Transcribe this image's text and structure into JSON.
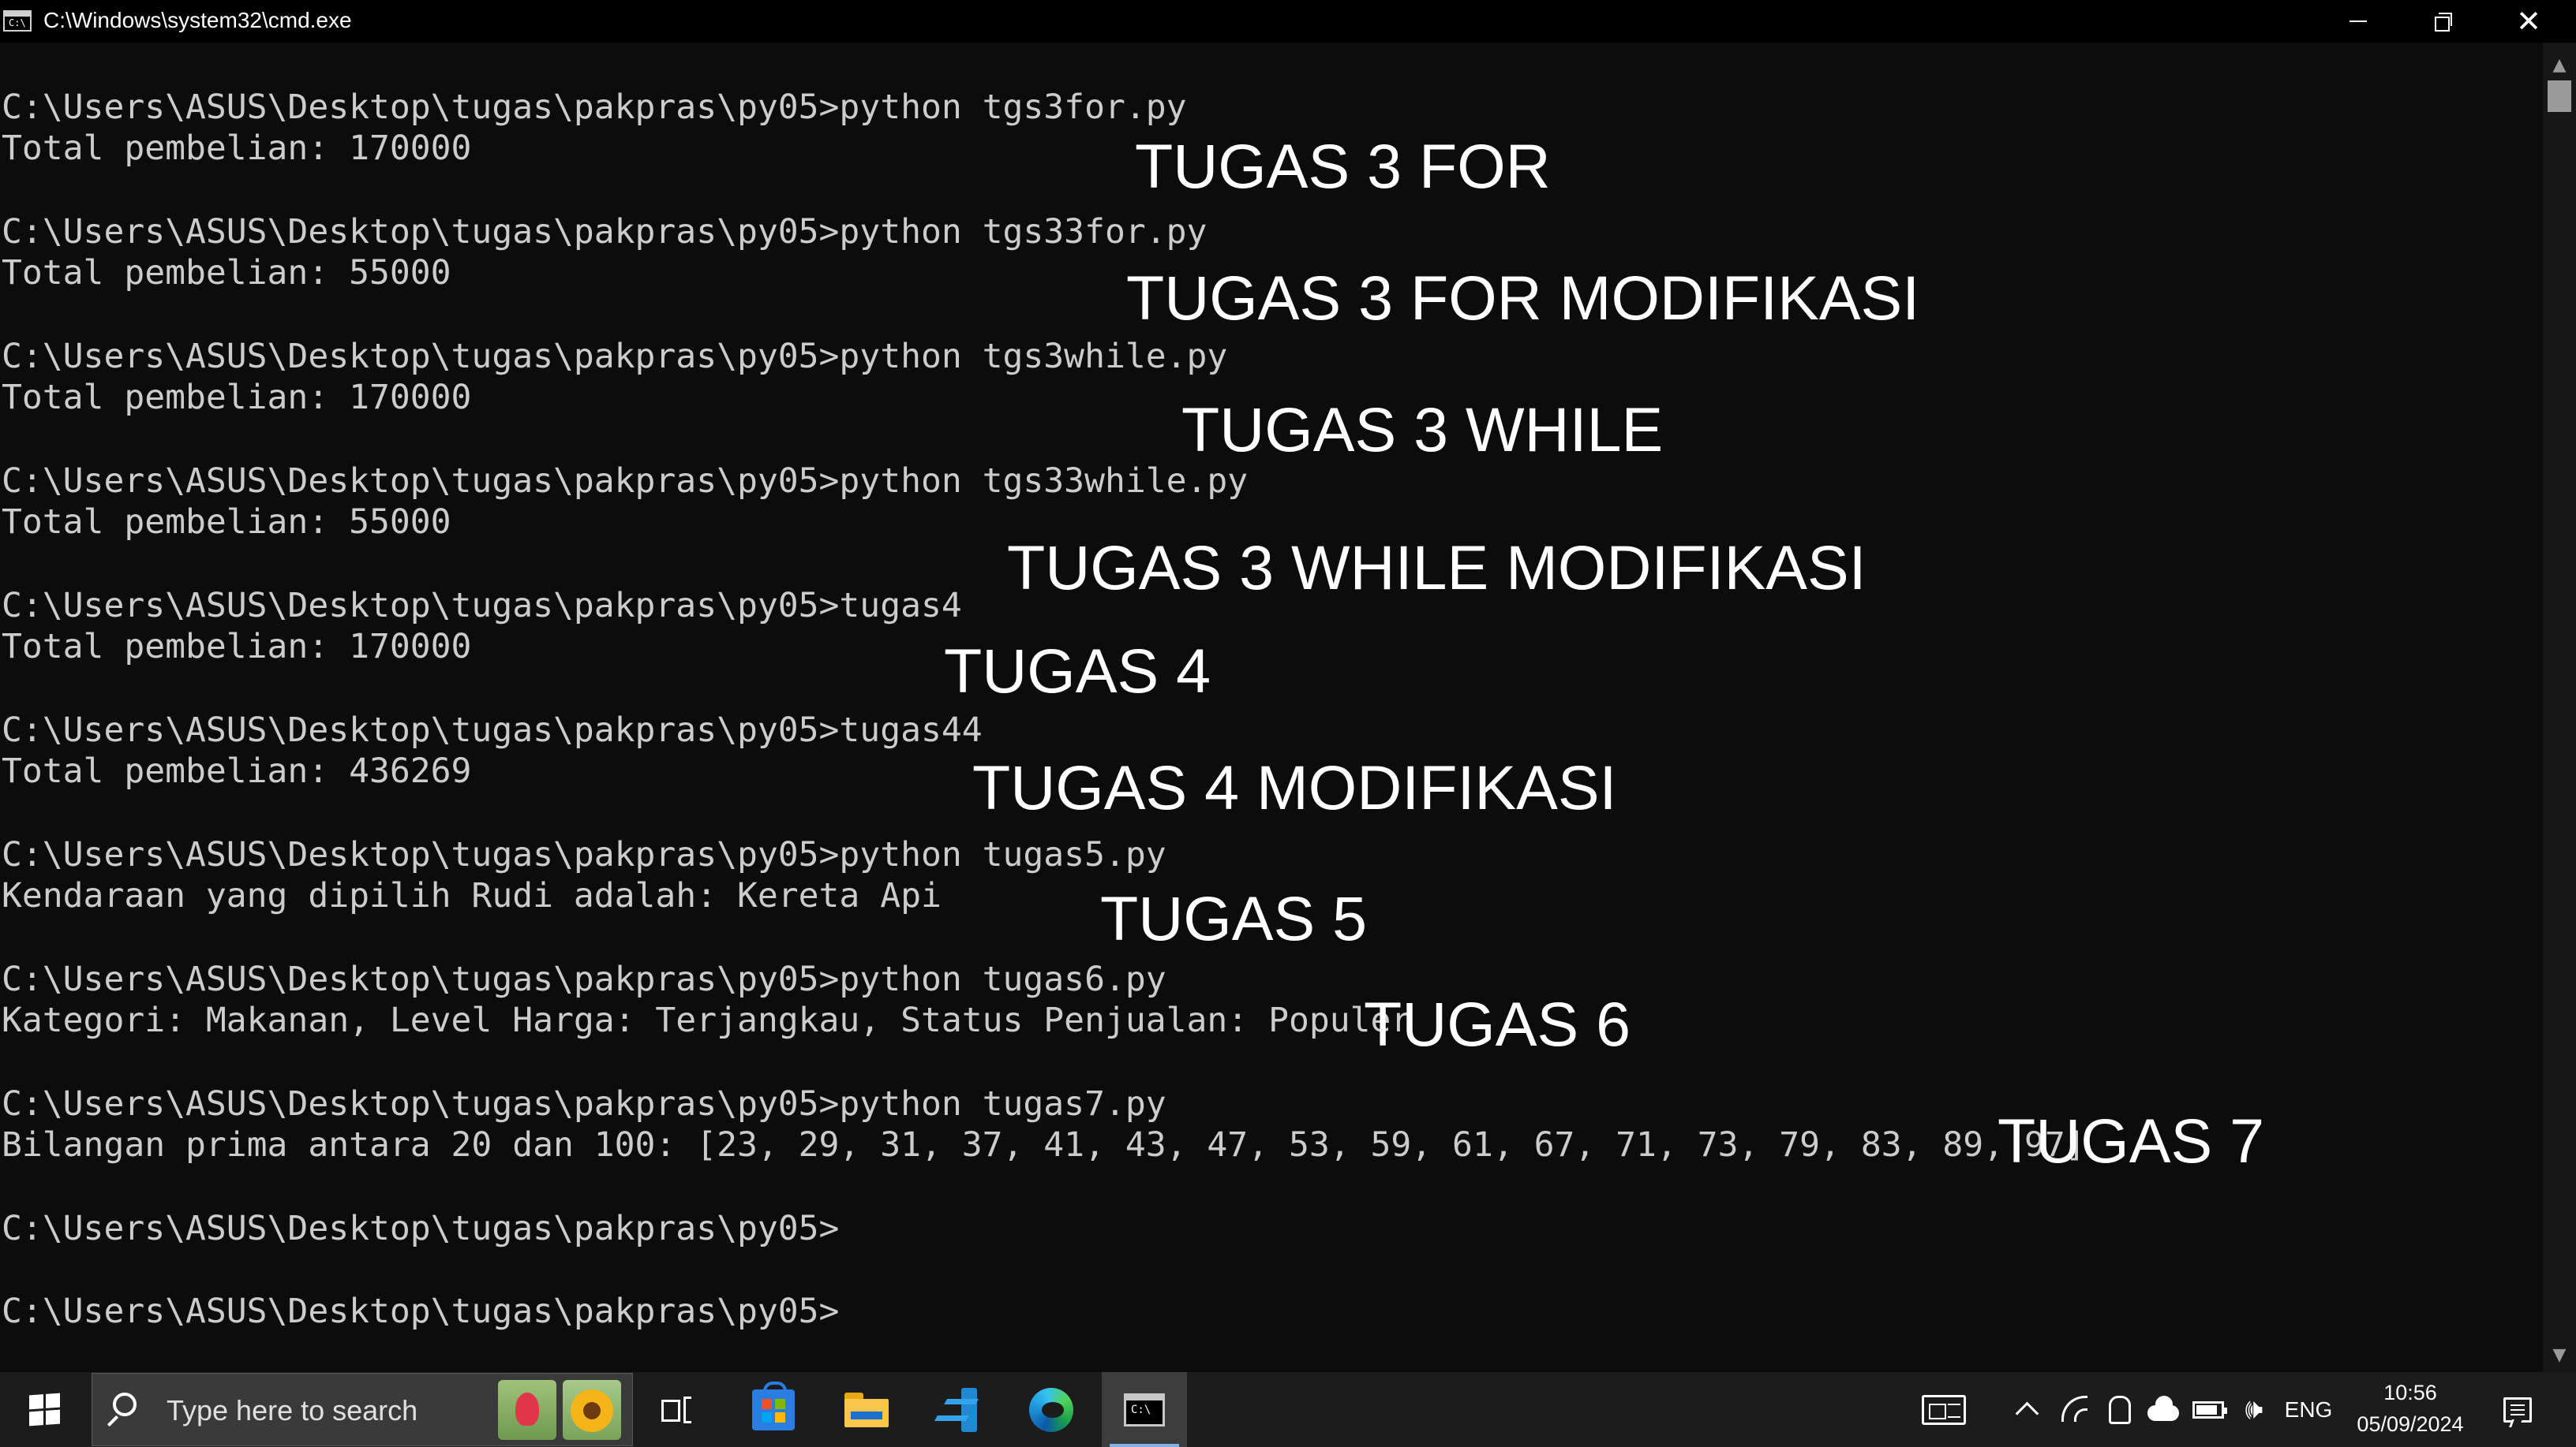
{
  "window": {
    "title": "C:\\Windows\\system32\\cmd.exe"
  },
  "terminal": {
    "lines": [
      "C:\\Users\\ASUS\\Desktop\\tugas\\pakpras\\py05>python tgs3for.py",
      "Total pembelian: 170000",
      "C:\\Users\\ASUS\\Desktop\\tugas\\pakpras\\py05>python tgs33for.py",
      "Total pembelian: 55000",
      "C:\\Users\\ASUS\\Desktop\\tugas\\pakpras\\py05>python tgs3while.py",
      "Total pembelian: 170000",
      "C:\\Users\\ASUS\\Desktop\\tugas\\pakpras\\py05>python tgs33while.py",
      "Total pembelian: 55000",
      "C:\\Users\\ASUS\\Desktop\\tugas\\pakpras\\py05>tugas4",
      "Total pembelian: 170000",
      "C:\\Users\\ASUS\\Desktop\\tugas\\pakpras\\py05>tugas44",
      "Total pembelian: 436269",
      "C:\\Users\\ASUS\\Desktop\\tugas\\pakpras\\py05>python tugas5.py",
      "Kendaraan yang dipilih Rudi adalah: Kereta Api",
      "C:\\Users\\ASUS\\Desktop\\tugas\\pakpras\\py05>python tugas6.py",
      "Kategori: Makanan, Level Harga: Terjangkau, Status Penjualan: Populer",
      "C:\\Users\\ASUS\\Desktop\\tugas\\pakpras\\py05>python tugas7.py",
      "Bilangan prima antara 20 dan 100: [23, 29, 31, 37, 41, 43, 47, 53, 59, 61, 67, 71, 73, 79, 83, 89, 97]",
      "C:\\Users\\ASUS\\Desktop\\tugas\\pakpras\\py05>",
      "C:\\Users\\ASUS\\Desktop\\tugas\\pakpras\\py05>"
    ]
  },
  "annotations": [
    "TUGAS 3 FOR",
    "TUGAS 3 FOR MODIFIKASI",
    "TUGAS 3 WHILE",
    "TUGAS 3 WHILE MODIFIKASI",
    "TUGAS 4",
    "TUGAS 4 MODIFIKASI",
    "TUGAS 5",
    "TUGAS 6",
    "TUGAS 7"
  ],
  "taskbar": {
    "search_placeholder": "Type here to search",
    "language": "ENG",
    "time": "10:56",
    "date": "05/09/2024"
  },
  "colors": {
    "terminal_bg": "#0c0c0c",
    "terminal_text": "#cccccc",
    "annotation_text": "#ffffff",
    "taskbar_bg": "#1c1c1c"
  }
}
